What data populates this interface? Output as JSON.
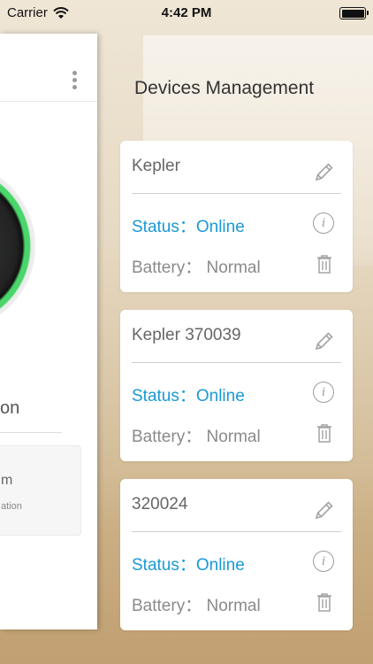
{
  "status_bar": {
    "carrier": "Carrier",
    "time": "4:42 PM"
  },
  "left_panel": {
    "partial_label": "on",
    "sub_card": {
      "line1": "m",
      "line2": "ation"
    }
  },
  "devices_title": "Devices Management",
  "devices": [
    {
      "name": "Kepler",
      "status_label": "Status：Online",
      "battery_label": "Battery： Normal"
    },
    {
      "name": "Kepler 370039",
      "status_label": "Status：Online",
      "battery_label": "Battery： Normal"
    },
    {
      "name": "320024",
      "status_label": "Status：Online",
      "battery_label": "Battery： Normal"
    }
  ],
  "colors": {
    "status_blue": "#1a99d6",
    "ring_green": "#49d66a"
  },
  "icons": {
    "edit": "pencil-icon",
    "info": "info-icon",
    "delete": "trash-icon",
    "menu": "more-vertical-icon",
    "wifi": "wifi-icon"
  }
}
